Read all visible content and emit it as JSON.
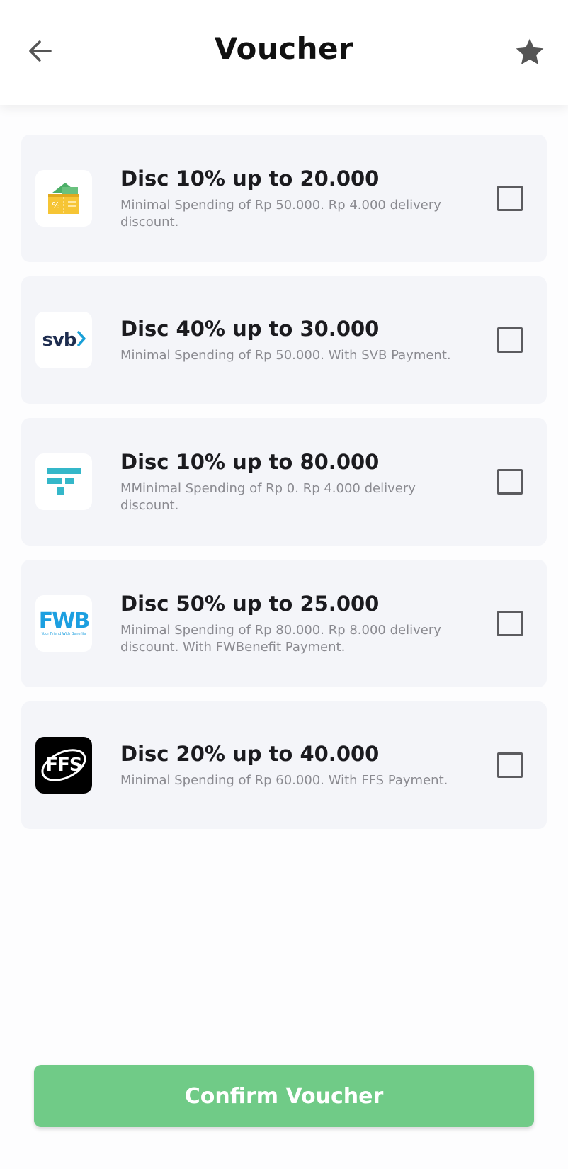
{
  "header": {
    "title": "Voucher",
    "back_icon": "arrow-left-icon",
    "favorite_icon": "star-icon"
  },
  "vouchers": [
    {
      "logo": "ticket-wallet-logo",
      "title": "Disc 10% up to 20.000",
      "description": "Minimal Spending of Rp 50.000. Rp 4.000 delivery discount.",
      "checked": false
    },
    {
      "logo": "svb-logo",
      "logo_text": "svb",
      "title": "Disc 40% up to 30.000",
      "description": "Minimal Spending of Rp 50.000. With SVB Payment.",
      "checked": false
    },
    {
      "logo": "f-bars-logo",
      "title": "Disc 10% up to 80.000",
      "description": "MMinimal Spending of Rp 0. Rp 4.000 delivery discount.",
      "checked": false
    },
    {
      "logo": "fwb-logo",
      "logo_text": "FWB",
      "logo_subtext": "Your Friend With Benefits",
      "title": "Disc 50% up to 25.000",
      "description": "Minimal Spending of Rp 80.000. Rp 8.000 delivery discount. With FWBenefit Payment.",
      "checked": false
    },
    {
      "logo": "ffs-logo",
      "logo_text": "FFS",
      "title": "Disc 20% up to 40.000",
      "description": "Minimal Spending of Rp 60.000. With FFS Payment.",
      "checked": false
    }
  ],
  "confirm_label": "Confirm Voucher",
  "colors": {
    "accent": "#70cb87",
    "card_bg": "#f4f5f9",
    "title_text": "#111111",
    "muted_text": "#8a8a90"
  }
}
